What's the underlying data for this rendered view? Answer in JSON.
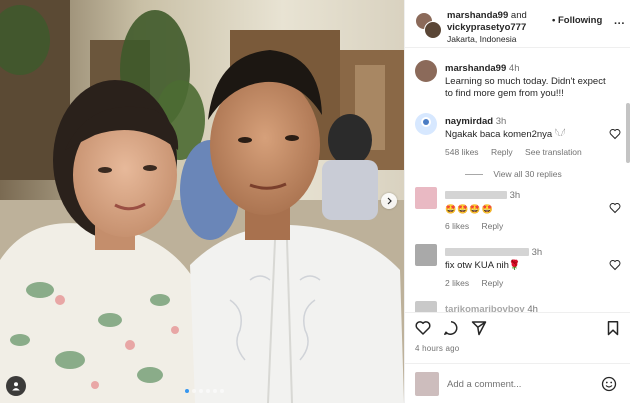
{
  "header": {
    "user1": "marshanda99",
    "and": "and",
    "user2": "vickyprasetyo777",
    "location": "Jakarta, Indonesia",
    "more_label": "•",
    "follow_label": "Following",
    "menu_label": "···"
  },
  "caption": {
    "user": "marshanda99",
    "time": "4h",
    "text": "Learning so much today. Didn't expect to find more gem from you!!!"
  },
  "comments": [
    {
      "user": "naymirdad",
      "time": "3h",
      "text": "Ngakak baca komen2nya 𓆩𓆪",
      "likes": "548 likes",
      "reply": "Reply",
      "translate": "See translation"
    },
    {
      "user": "",
      "time": "3h",
      "text": "🤩🤩🤩🤩",
      "likes": "6 likes",
      "reply": "Reply"
    },
    {
      "user": "",
      "time": "3h",
      "text": "fix otw KUA nih🌹",
      "likes": "2 likes",
      "reply": "Reply"
    },
    {
      "user": "tarikomaribovbov",
      "time": "4h",
      "text": ""
    }
  ],
  "view_replies": "View all 30 replies",
  "posted_time": "4 hours ago",
  "add_comment": {
    "placeholder": "Add a comment..."
  },
  "colors": {
    "accent": "#3797f0",
    "text": "#262626",
    "secondary": "#737373",
    "border": "#efefef"
  },
  "icons": {
    "like": "heart-icon",
    "comment": "comment-icon",
    "share": "paper-plane-icon",
    "save": "bookmark-icon",
    "next": "chevron-right-icon",
    "tags": "user-tag-icon",
    "emoji": "smiley-icon"
  }
}
